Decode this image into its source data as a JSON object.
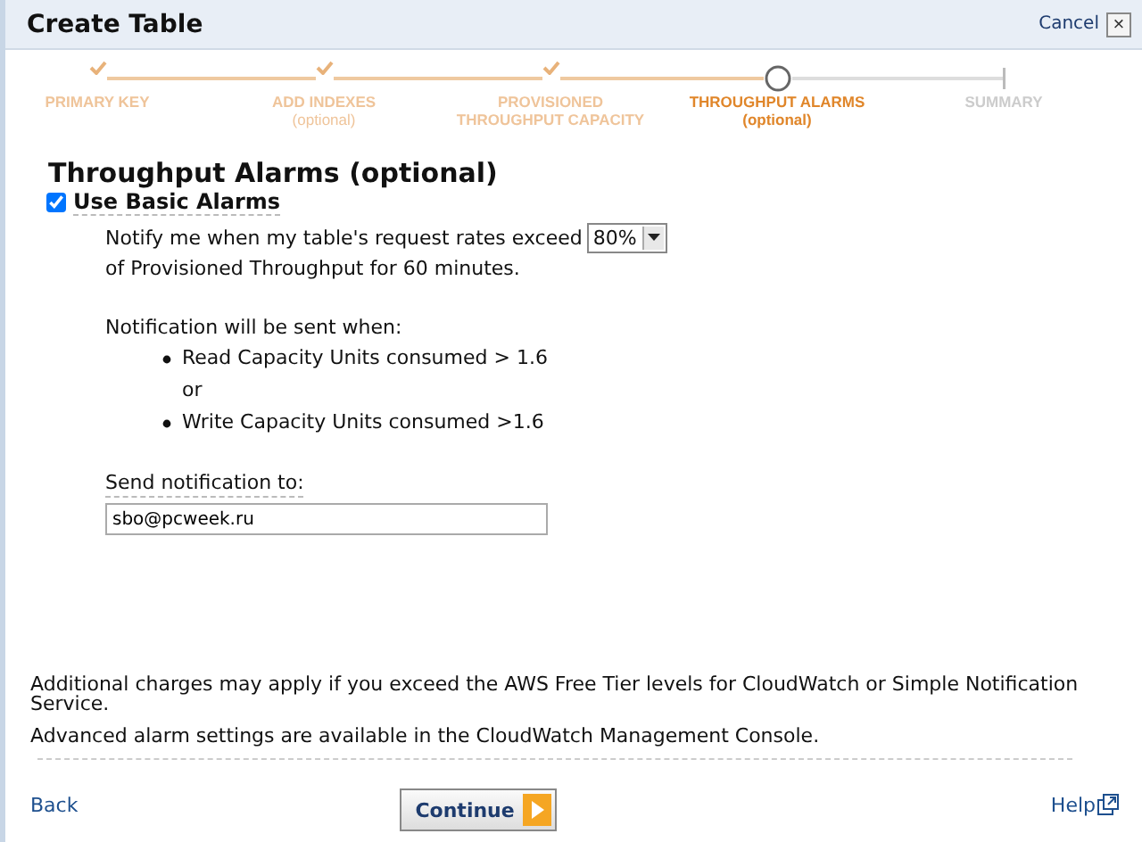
{
  "window": {
    "title": "Create Table",
    "cancel": "Cancel",
    "close": "×"
  },
  "steps": [
    {
      "label": "PRIMARY KEY",
      "completed": true,
      "selected": false
    },
    {
      "label": "ADD INDEXES",
      "sublabel": "(optional)",
      "completed": true,
      "selected": false
    },
    {
      "label": "PROVISIONED THROUGHPUT CAPACITY",
      "completed": true,
      "selected": false
    },
    {
      "label": "THROUGHPUT ALARMS",
      "sublabel": "(optional)",
      "completed": false,
      "selected": true
    },
    {
      "label": "SUMMARY",
      "completed": false,
      "selected": false
    }
  ],
  "heading": "Throughput Alarms (optional)",
  "use_basic_alarms": {
    "label": "Use Basic Alarms",
    "checked": true
  },
  "notify_text": "Notify me when my table's request rates exceed",
  "threshold": {
    "value": "80%"
  },
  "notify_text_2": "of Provisioned Throughput for 60 minutes.",
  "condition_intro": "Notification will be sent when:",
  "conditions": [
    {
      "kind": "bullet",
      "text": "Read Capacity Units consumed > 1.6"
    },
    {
      "kind": "plain",
      "text": "or"
    },
    {
      "kind": "bullet",
      "text": "Write Capacity Units consumed >1.6"
    }
  ],
  "email": {
    "label": "Send notification to:",
    "value": "sbo@pcweek.ru"
  },
  "notes": [
    "Additional charges may apply if you exceed the AWS Free Tier levels for CloudWatch or Simple Notification Service.",
    "Advanced alarm settings are available in the CloudWatch Management Console."
  ],
  "footer": {
    "back": "Back",
    "continue": "Continue",
    "help": "Help"
  }
}
